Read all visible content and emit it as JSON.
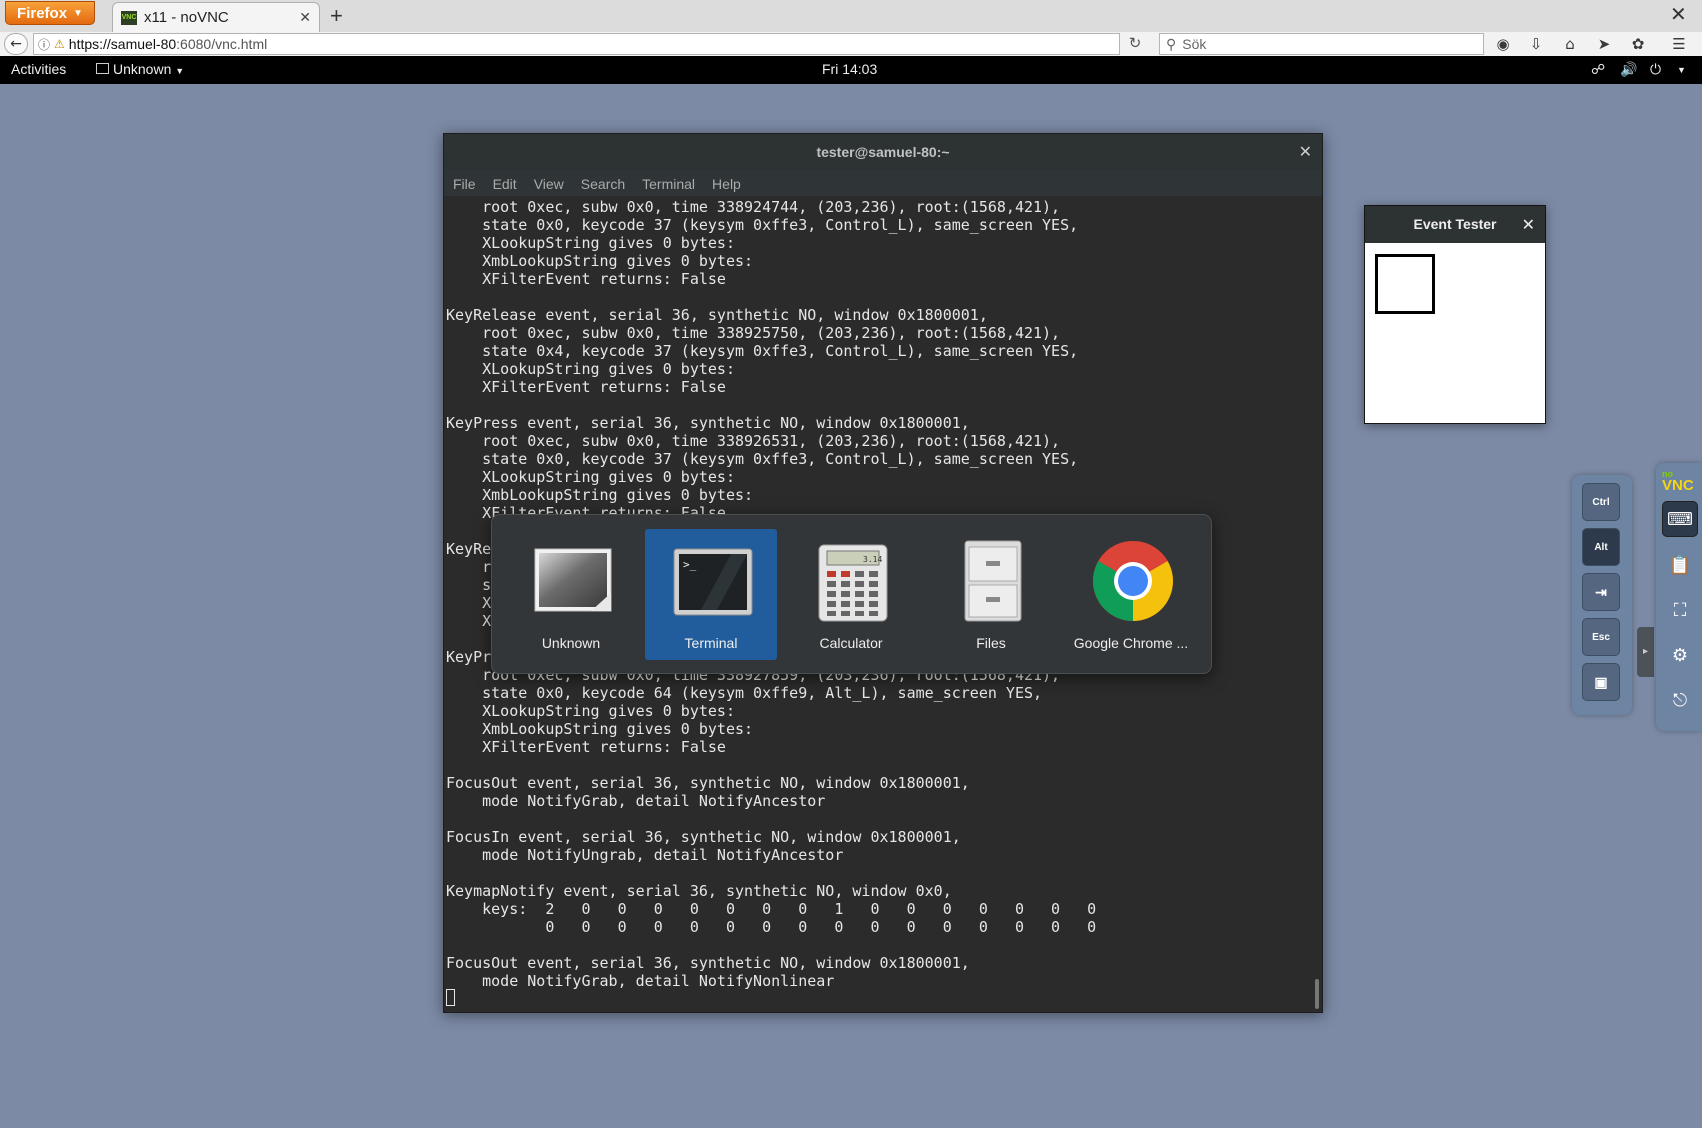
{
  "browser": {
    "app_button": "Firefox",
    "tab_title": "x11 - noVNC",
    "tab_favicon": "VNC",
    "url_host": "https://samuel-80",
    "url_rest": ":6080/vnc.html",
    "search_placeholder": "Sök"
  },
  "topbar": {
    "activities": "Activities",
    "app_menu": "Unknown",
    "clock": "Fri 14:03"
  },
  "terminal": {
    "title": "tester@samuel-80:~",
    "menu": [
      "File",
      "Edit",
      "View",
      "Search",
      "Terminal",
      "Help"
    ],
    "output": "    root 0xec, subw 0x0, time 338924744, (203,236), root:(1568,421),\n    state 0x0, keycode 37 (keysym 0xffe3, Control_L), same_screen YES,\n    XLookupString gives 0 bytes: \n    XmbLookupString gives 0 bytes: \n    XFilterEvent returns: False\n\nKeyRelease event, serial 36, synthetic NO, window 0x1800001,\n    root 0xec, subw 0x0, time 338925750, (203,236), root:(1568,421),\n    state 0x4, keycode 37 (keysym 0xffe3, Control_L), same_screen YES,\n    XLookupString gives 0 bytes: \n    XFilterEvent returns: False\n\nKeyPress event, serial 36, synthetic NO, window 0x1800001,\n    root 0xec, subw 0x0, time 338926531, (203,236), root:(1568,421),\n    state 0x0, keycode 37 (keysym 0xffe3, Control_L), same_screen YES,\n    XLookupString gives 0 bytes: \n    XmbLookupString gives 0 bytes: \n    XFilterEvent returns: False\n\nKeyRe\n    r\n    s\n    X\n    X\n\nKeyPr\n    root 0xec, subw 0x0, time 338927859, (203,236), root:(1568,421),\n    state 0x0, keycode 64 (keysym 0xffe9, Alt_L), same_screen YES,\n    XLookupString gives 0 bytes: \n    XmbLookupString gives 0 bytes: \n    XFilterEvent returns: False\n\nFocusOut event, serial 36, synthetic NO, window 0x1800001,\n    mode NotifyGrab, detail NotifyAncestor\n\nFocusIn event, serial 36, synthetic NO, window 0x1800001,\n    mode NotifyUngrab, detail NotifyAncestor\n\nKeymapNotify event, serial 36, synthetic NO, window 0x0,\n    keys:  2   0   0   0   0   0   0   0   1   0   0   0   0   0   0   0   \n           0   0   0   0   0   0   0   0   0   0   0   0   0   0   0   0   \n\nFocusOut event, serial 36, synthetic NO, window 0x1800001,\n    mode NotifyGrab, detail NotifyNonlinear\n"
  },
  "switcher": {
    "items": [
      {
        "label": "Unknown",
        "icon": "generic-window-icon",
        "selected": false
      },
      {
        "label": "Terminal",
        "icon": "terminal-icon",
        "selected": true
      },
      {
        "label": "Calculator",
        "icon": "calculator-icon",
        "selected": false
      },
      {
        "label": "Files",
        "icon": "files-cabinet-icon",
        "selected": false
      },
      {
        "label": "Google Chrome ...",
        "icon": "chrome-icon",
        "selected": false
      }
    ],
    "selected_color": "#215d9c"
  },
  "event_tester": {
    "title": "Event Tester"
  },
  "novnc": {
    "logo_top": "no",
    "logo_bottom": "VNC",
    "extra_keys": [
      "Ctrl",
      "Alt",
      "Tab",
      "Esc",
      "Ctrl+Alt+Del"
    ],
    "extra_key_labels": {
      "ctrl": "Ctrl",
      "alt": "Alt",
      "esc": "Esc"
    },
    "alt_active": true,
    "buttons": [
      "keyboard-icon",
      "clipboard-icon",
      "fullscreen-icon",
      "settings-gear-icon",
      "disconnect-icon"
    ]
  },
  "colors": {
    "desktop": "#7c8aa5",
    "terminal_bg": "#2b2b2b",
    "novnc_panel": "#6e84a3"
  }
}
